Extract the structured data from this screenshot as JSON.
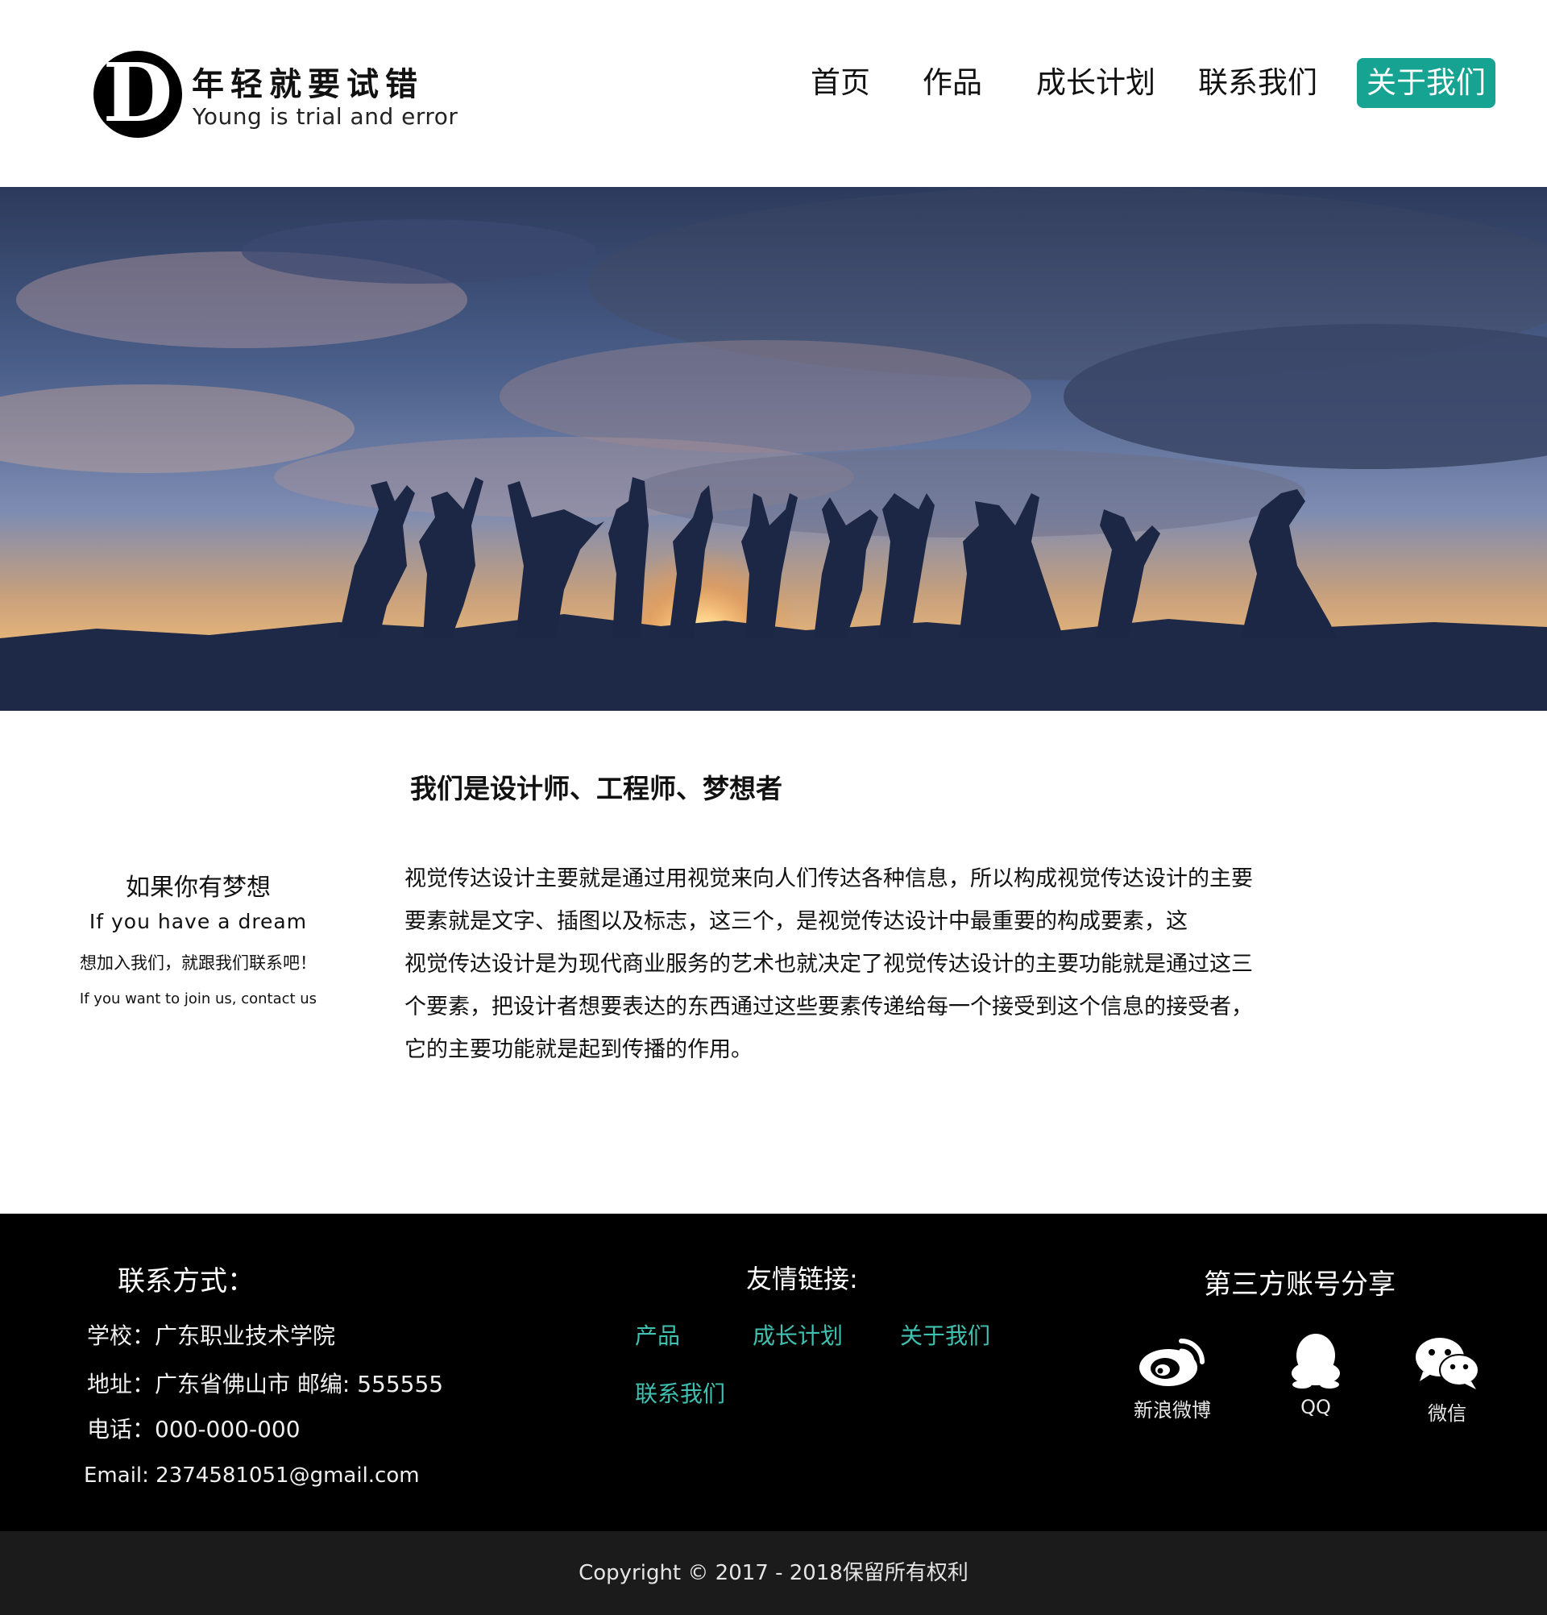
{
  "brand": {
    "logo_letter": "D",
    "title_cn": "年轻就要试错",
    "title_en": "Young is trial and error"
  },
  "nav": {
    "items": [
      "首页",
      "作品",
      "成长计划",
      "联系我们",
      "关于我们"
    ],
    "active": "关于我们",
    "active_color": "#17a391"
  },
  "banner": {
    "image": "silhouettes of people jumping at sunset under a cloudy sky"
  },
  "content": {
    "headline": "我们是设计师、工程师、梦想者",
    "side": {
      "title_cn": "如果你有梦想",
      "title_en": "If you have a dream",
      "subtitle_cn": "想加入我们，就跟我们联系吧！",
      "subtitle_en": "If you want to join us, contact us"
    },
    "paragraph_lines": [
      "视觉传达设计主要就是通过用视觉来向人们传达各种信息，所以构成视觉传达设计的主要",
      "要素就是文字、插图以及标志，这三个，是视觉传达设计中最重要的构成要素，这",
      "视觉传达设计是为现代商业服务的艺术也就决定了视觉传达设计的主要功能就是通过这三",
      "个要素，把设计者想要表达的东西通过这些要素传递给每一个接受到这个信息的接受者，",
      "它的主要功能就是起到传播的作用。"
    ]
  },
  "footer": {
    "contact": {
      "title": "联系方式：",
      "school": "学校：广东职业技术学院",
      "address": "地址：广东省佛山市 邮编: 555555",
      "phone": "电话：000-000-000",
      "email": "Email: 2374581051@gmail.com"
    },
    "links": {
      "title": "友情链接:",
      "items": [
        "产品",
        "成长计划",
        "关于我们",
        "联系我们"
      ],
      "color": "#3fc0b0"
    },
    "share": {
      "title": "第三方账号分享",
      "items": [
        {
          "label": "新浪微博",
          "icon": "weibo-icon"
        },
        {
          "label": "QQ",
          "icon": "qq-icon"
        },
        {
          "label": "微信",
          "icon": "wechat-icon"
        }
      ]
    },
    "copyright": "Copyright © 2017 - 2018保留所有权利"
  }
}
